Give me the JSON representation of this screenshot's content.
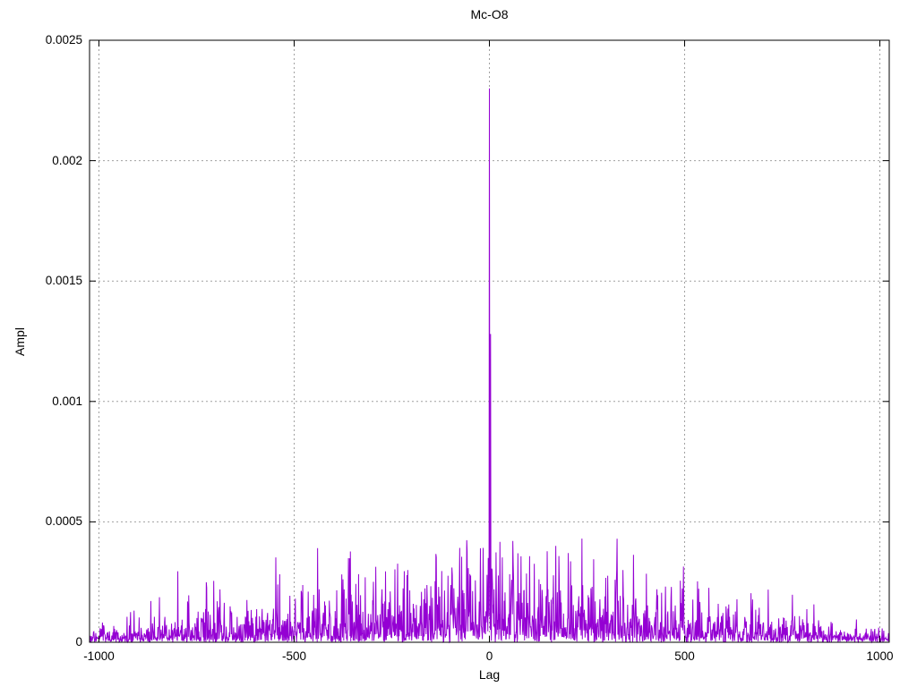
{
  "chart_data": {
    "type": "line",
    "subtype": "impulse-noise-correlation",
    "title": "Mc-O8",
    "xlabel": "Lag",
    "ylabel": "Ampl",
    "xlim": [
      -1024,
      1024
    ],
    "ylim": [
      0,
      0.0025
    ],
    "xticks": [
      {
        "value": -1000,
        "label": "-1000"
      },
      {
        "value": -500,
        "label": "-500"
      },
      {
        "value": 0,
        "label": "0"
      },
      {
        "value": 500,
        "label": "500"
      },
      {
        "value": 1000,
        "label": "1000"
      }
    ],
    "yticks": [
      {
        "value": 0,
        "label": "0"
      },
      {
        "value": 0.0005,
        "label": "0.0005"
      },
      {
        "value": 0.001,
        "label": "0.001"
      },
      {
        "value": 0.0015,
        "label": "0.0015"
      },
      {
        "value": 0.002,
        "label": "0.002"
      },
      {
        "value": 0.0025,
        "label": "0.0025"
      }
    ],
    "grid": {
      "visible": true,
      "style": "dotted",
      "color": "#a0a0a0"
    },
    "border_color": "#000000",
    "line_color": "#9400d3",
    "legend": "none",
    "main_peak": {
      "lag": 0,
      "ampl": 0.0023
    },
    "secondary_peak": {
      "lag": 3,
      "ampl": 0.00128
    },
    "center_cluster": [
      {
        "lag": -6,
        "ampl": 0.00028
      },
      {
        "lag": -3,
        "ampl": 0.00035
      },
      {
        "lag": 1,
        "ampl": 0.00041
      },
      {
        "lag": 7,
        "ampl": 0.0003
      },
      {
        "lag": 12,
        "ampl": 0.00022
      }
    ],
    "notable_spikes": [
      {
        "lag": -542,
        "ampl": 0.00024
      },
      {
        "lag": -318,
        "ampl": 0.00027
      },
      {
        "lag": -275,
        "ampl": 0.00022
      },
      {
        "lag": -130,
        "ampl": 0.00023
      },
      {
        "lag": 150,
        "ampl": 0.00022
      },
      {
        "lag": 326,
        "ampl": 0.0003
      },
      {
        "lag": 466,
        "ampl": 0.00023
      }
    ],
    "noise": {
      "envelope": "triangular",
      "edge_mean_ampl": 2.2e-05,
      "center_mean_ampl": 0.000125,
      "max_typical_ampl": 0.00038,
      "n_points": 2049,
      "seed": 9
    }
  }
}
